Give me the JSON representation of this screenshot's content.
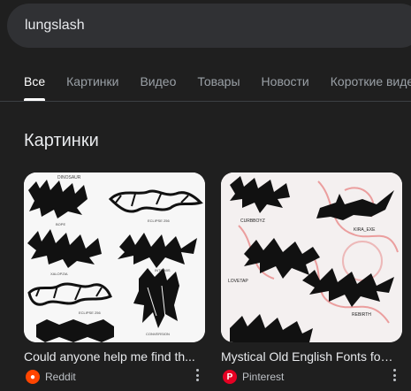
{
  "search": {
    "query": "lungslash"
  },
  "tabs": [
    {
      "label": "Все",
      "active": true
    },
    {
      "label": "Картинки"
    },
    {
      "label": "Видео"
    },
    {
      "label": "Товары"
    },
    {
      "label": "Новости"
    },
    {
      "label": "Короткие виде"
    }
  ],
  "images_section": {
    "title": "Картинки",
    "cards": [
      {
        "title": "Could anyone help me find th...",
        "source": "Reddit",
        "source_icon": "reddit-icon",
        "thumb_labels": [
          "DINOSAUR",
          "BOPE",
          "ECLIPSE 256",
          "XALOPZIA",
          "INTRIMIS",
          "ECLIPSE 256",
          "CONVERSION"
        ]
      },
      {
        "title": "Mystical Old English Fonts for...",
        "source": "Pinterest",
        "source_icon": "pinterest-icon",
        "thumb_labels": [
          "CURBBOYZ",
          "KIRA_EXE",
          "LOVETAP",
          "REBIRTH"
        ]
      }
    ]
  },
  "colors": {
    "background": "#1f1f1f",
    "search_bg": "#303134",
    "reddit": "#ff4500",
    "pinterest": "#e60023"
  }
}
